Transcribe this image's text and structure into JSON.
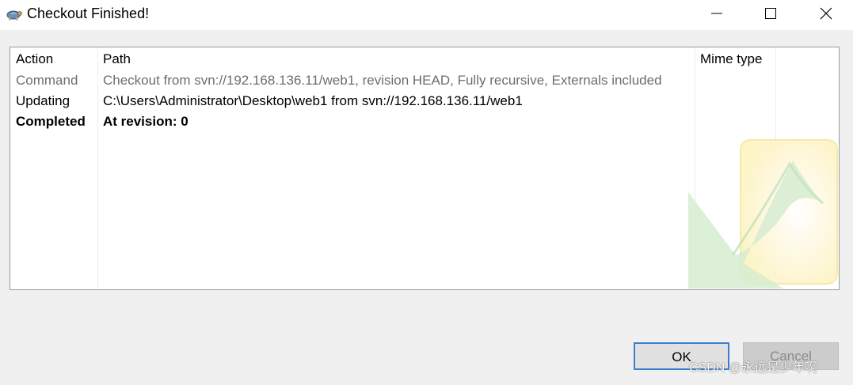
{
  "window": {
    "title": "Checkout Finished!",
    "icon": "tortoisesvn-icon"
  },
  "columns": [
    "Action",
    "Path",
    "Mime type"
  ],
  "rows": [
    {
      "action": "Command",
      "path": "Checkout from svn://192.168.136.11/web1, revision HEAD, Fully recursive, Externals included",
      "style": "gray"
    },
    {
      "action": "Updating",
      "path": "C:\\Users\\Administrator\\Desktop\\web1 from svn://192.168.136.11/web1",
      "style": "normal"
    },
    {
      "action": "Completed",
      "path": "At revision: 0",
      "style": "bold"
    }
  ],
  "buttons": {
    "ok": "OK",
    "cancel": "Cancel"
  },
  "watermark_text": "CSDN @永远是少年啊",
  "colors": {
    "accent": "#3c7fd1",
    "gray_text": "#6d6d6d"
  }
}
